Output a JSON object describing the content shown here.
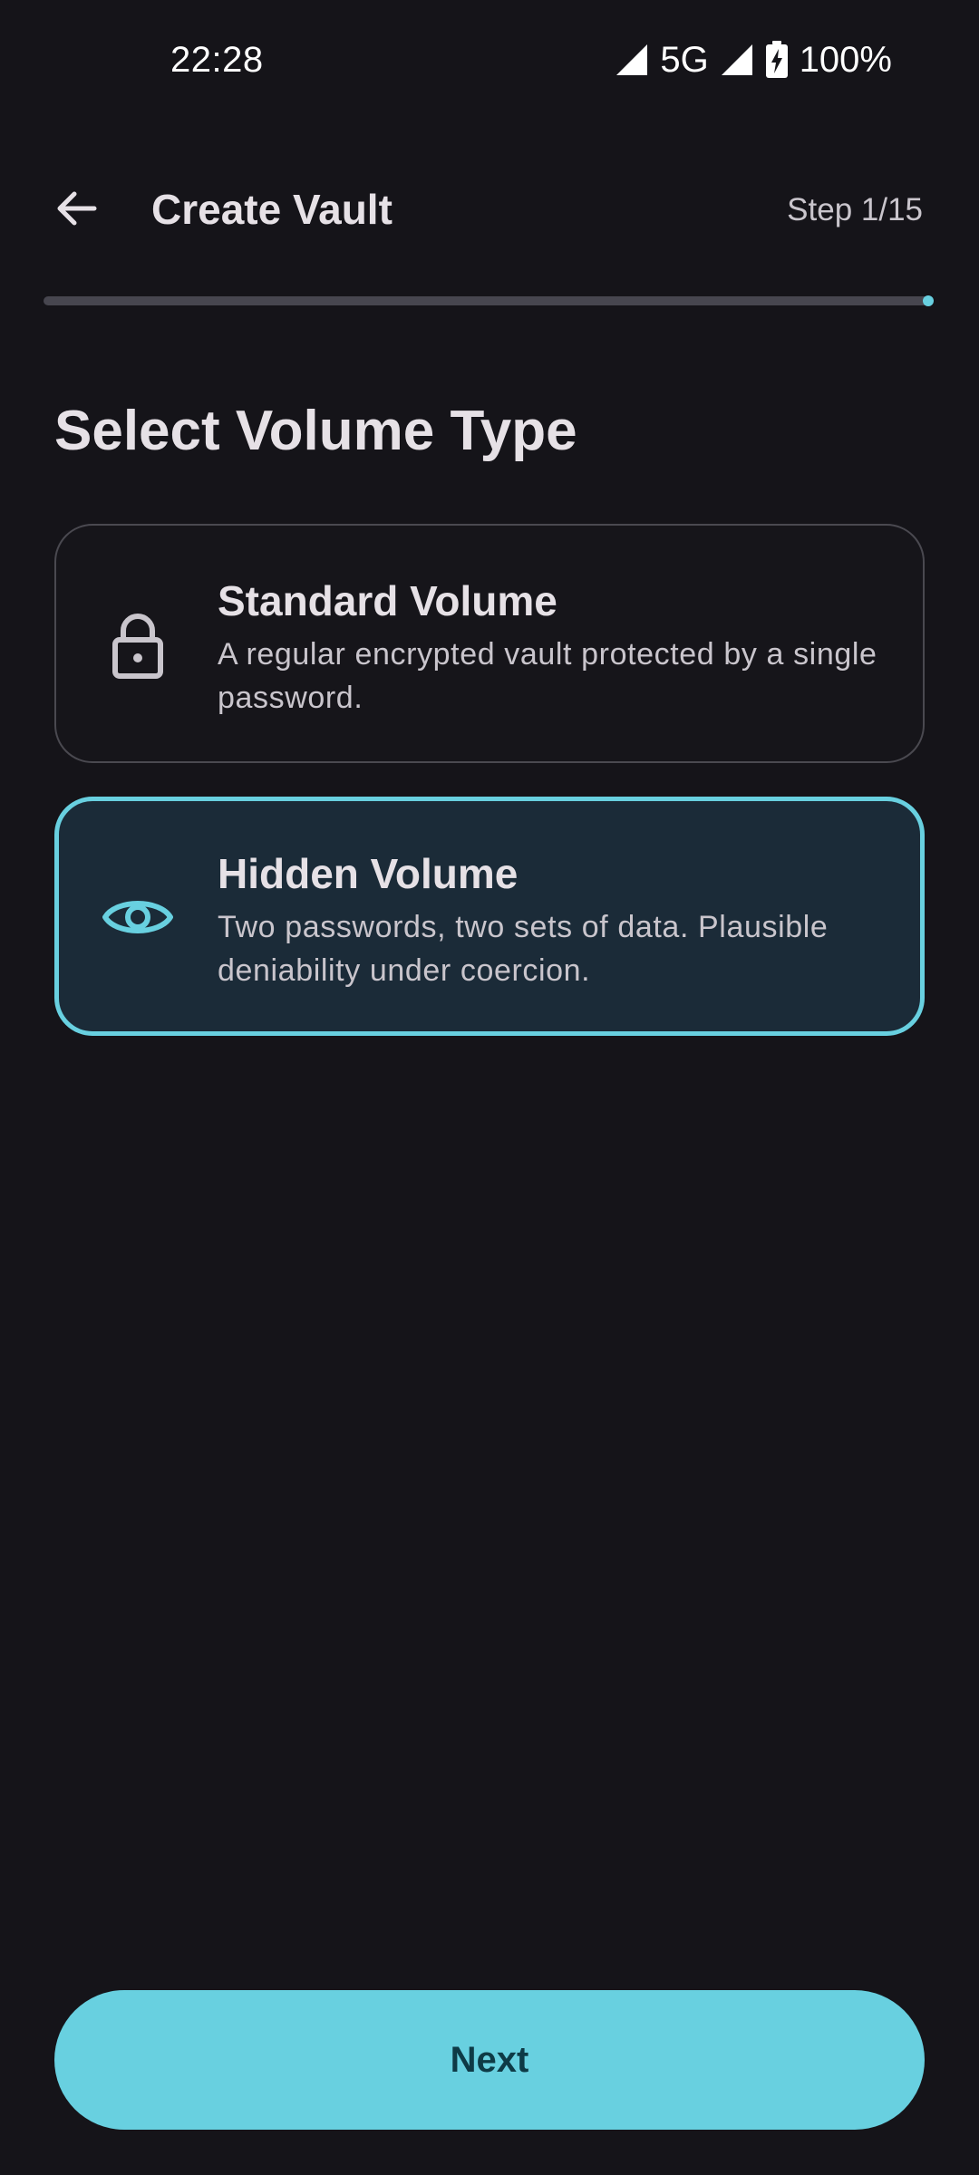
{
  "status_bar": {
    "time": "22:28",
    "network": "5G",
    "battery": "100%",
    "icons": [
      "signal-icon",
      "signal-icon",
      "battery-charging-icon"
    ]
  },
  "app_bar": {
    "title": "Create Vault",
    "step": "Step 1/15",
    "back_icon": "arrow-back-icon"
  },
  "progress": {
    "fraction": 1.0
  },
  "page": {
    "title": "Select Volume Type"
  },
  "options": [
    {
      "title": "Standard Volume",
      "description": "A regular encrypted vault protected by a single password.",
      "icon": "lock-icon",
      "selected": false
    },
    {
      "title": "Hidden Volume",
      "description": "Two passwords, two sets of data. Plausible deniability under coercion.",
      "icon": "eye-icon",
      "selected": true
    }
  ],
  "footer": {
    "next_label": "Next"
  },
  "colors": {
    "background": "#151419",
    "accent": "#68D0E0",
    "selected_card": "#1B2B38",
    "text_primary": "#E6E1E6",
    "text_secondary": "#C9C5CC"
  }
}
